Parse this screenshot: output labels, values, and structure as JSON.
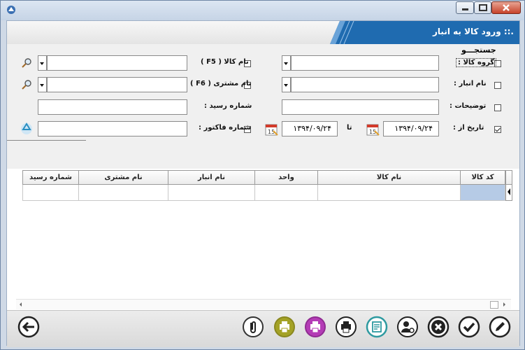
{
  "window": {
    "title": ".:: ورود کالا به انبار"
  },
  "search": {
    "legend": "جستجـــو",
    "group_label": "گروه کالا :",
    "warehouse_label": "نام انبار :",
    "description_label": "توضیحات :",
    "date_from_label": "تاریخ از :",
    "date_from_value": "۱۳۹۴/۰۹/۲۴",
    "date_to_label": "تا",
    "date_to_value": "۱۳۹۴/۰۹/۲۴",
    "product_name_label": "نام کالا ( F5 )",
    "customer_name_label": "نام مشتری ( F6 )",
    "receipt_no_label": "شماره رسید :",
    "invoice_no_label": "شماره فاکتور :",
    "date_from_checked": true
  },
  "grid": {
    "columns": [
      "کد کالا",
      "نام کالا",
      "واحد",
      "نام انبار",
      "نام مشتری",
      "شماره رسید"
    ]
  },
  "toolbar": {
    "icons": [
      "edit-icon",
      "confirm-icon",
      "cancel-icon",
      "user-search-icon",
      "report-icon",
      "print-icon",
      "print-purple-icon",
      "print-olive-icon",
      "attachment-icon",
      "back-arrow-icon"
    ]
  },
  "colors": {
    "banner_blue": "#1f6bb0",
    "toolbar_olive": "#a4a226",
    "toolbar_purple": "#b43cb6",
    "toolbar_teal": "#2e9aa0",
    "grid_selected": "#b6cbe6"
  }
}
